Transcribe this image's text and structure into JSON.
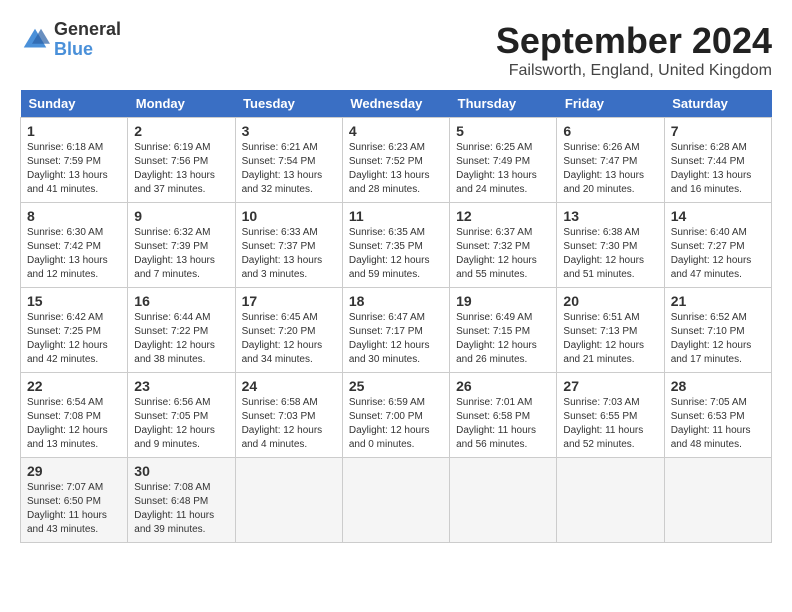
{
  "logo": {
    "general": "General",
    "blue": "Blue"
  },
  "title": "September 2024",
  "location": "Failsworth, England, United Kingdom",
  "days_of_week": [
    "Sunday",
    "Monday",
    "Tuesday",
    "Wednesday",
    "Thursday",
    "Friday",
    "Saturday"
  ],
  "weeks": [
    [
      {
        "day": "1",
        "info": "Sunrise: 6:18 AM\nSunset: 7:59 PM\nDaylight: 13 hours\nand 41 minutes."
      },
      {
        "day": "2",
        "info": "Sunrise: 6:19 AM\nSunset: 7:56 PM\nDaylight: 13 hours\nand 37 minutes."
      },
      {
        "day": "3",
        "info": "Sunrise: 6:21 AM\nSunset: 7:54 PM\nDaylight: 13 hours\nand 32 minutes."
      },
      {
        "day": "4",
        "info": "Sunrise: 6:23 AM\nSunset: 7:52 PM\nDaylight: 13 hours\nand 28 minutes."
      },
      {
        "day": "5",
        "info": "Sunrise: 6:25 AM\nSunset: 7:49 PM\nDaylight: 13 hours\nand 24 minutes."
      },
      {
        "day": "6",
        "info": "Sunrise: 6:26 AM\nSunset: 7:47 PM\nDaylight: 13 hours\nand 20 minutes."
      },
      {
        "day": "7",
        "info": "Sunrise: 6:28 AM\nSunset: 7:44 PM\nDaylight: 13 hours\nand 16 minutes."
      }
    ],
    [
      {
        "day": "8",
        "info": "Sunrise: 6:30 AM\nSunset: 7:42 PM\nDaylight: 13 hours\nand 12 minutes."
      },
      {
        "day": "9",
        "info": "Sunrise: 6:32 AM\nSunset: 7:39 PM\nDaylight: 13 hours\nand 7 minutes."
      },
      {
        "day": "10",
        "info": "Sunrise: 6:33 AM\nSunset: 7:37 PM\nDaylight: 13 hours\nand 3 minutes."
      },
      {
        "day": "11",
        "info": "Sunrise: 6:35 AM\nSunset: 7:35 PM\nDaylight: 12 hours\nand 59 minutes."
      },
      {
        "day": "12",
        "info": "Sunrise: 6:37 AM\nSunset: 7:32 PM\nDaylight: 12 hours\nand 55 minutes."
      },
      {
        "day": "13",
        "info": "Sunrise: 6:38 AM\nSunset: 7:30 PM\nDaylight: 12 hours\nand 51 minutes."
      },
      {
        "day": "14",
        "info": "Sunrise: 6:40 AM\nSunset: 7:27 PM\nDaylight: 12 hours\nand 47 minutes."
      }
    ],
    [
      {
        "day": "15",
        "info": "Sunrise: 6:42 AM\nSunset: 7:25 PM\nDaylight: 12 hours\nand 42 minutes."
      },
      {
        "day": "16",
        "info": "Sunrise: 6:44 AM\nSunset: 7:22 PM\nDaylight: 12 hours\nand 38 minutes."
      },
      {
        "day": "17",
        "info": "Sunrise: 6:45 AM\nSunset: 7:20 PM\nDaylight: 12 hours\nand 34 minutes."
      },
      {
        "day": "18",
        "info": "Sunrise: 6:47 AM\nSunset: 7:17 PM\nDaylight: 12 hours\nand 30 minutes."
      },
      {
        "day": "19",
        "info": "Sunrise: 6:49 AM\nSunset: 7:15 PM\nDaylight: 12 hours\nand 26 minutes."
      },
      {
        "day": "20",
        "info": "Sunrise: 6:51 AM\nSunset: 7:13 PM\nDaylight: 12 hours\nand 21 minutes."
      },
      {
        "day": "21",
        "info": "Sunrise: 6:52 AM\nSunset: 7:10 PM\nDaylight: 12 hours\nand 17 minutes."
      }
    ],
    [
      {
        "day": "22",
        "info": "Sunrise: 6:54 AM\nSunset: 7:08 PM\nDaylight: 12 hours\nand 13 minutes."
      },
      {
        "day": "23",
        "info": "Sunrise: 6:56 AM\nSunset: 7:05 PM\nDaylight: 12 hours\nand 9 minutes."
      },
      {
        "day": "24",
        "info": "Sunrise: 6:58 AM\nSunset: 7:03 PM\nDaylight: 12 hours\nand 4 minutes."
      },
      {
        "day": "25",
        "info": "Sunrise: 6:59 AM\nSunset: 7:00 PM\nDaylight: 12 hours\nand 0 minutes."
      },
      {
        "day": "26",
        "info": "Sunrise: 7:01 AM\nSunset: 6:58 PM\nDaylight: 11 hours\nand 56 minutes."
      },
      {
        "day": "27",
        "info": "Sunrise: 7:03 AM\nSunset: 6:55 PM\nDaylight: 11 hours\nand 52 minutes."
      },
      {
        "day": "28",
        "info": "Sunrise: 7:05 AM\nSunset: 6:53 PM\nDaylight: 11 hours\nand 48 minutes."
      }
    ],
    [
      {
        "day": "29",
        "info": "Sunrise: 7:07 AM\nSunset: 6:50 PM\nDaylight: 11 hours\nand 43 minutes."
      },
      {
        "day": "30",
        "info": "Sunrise: 7:08 AM\nSunset: 6:48 PM\nDaylight: 11 hours\nand 39 minutes."
      },
      {
        "day": "",
        "info": ""
      },
      {
        "day": "",
        "info": ""
      },
      {
        "day": "",
        "info": ""
      },
      {
        "day": "",
        "info": ""
      },
      {
        "day": "",
        "info": ""
      }
    ]
  ]
}
